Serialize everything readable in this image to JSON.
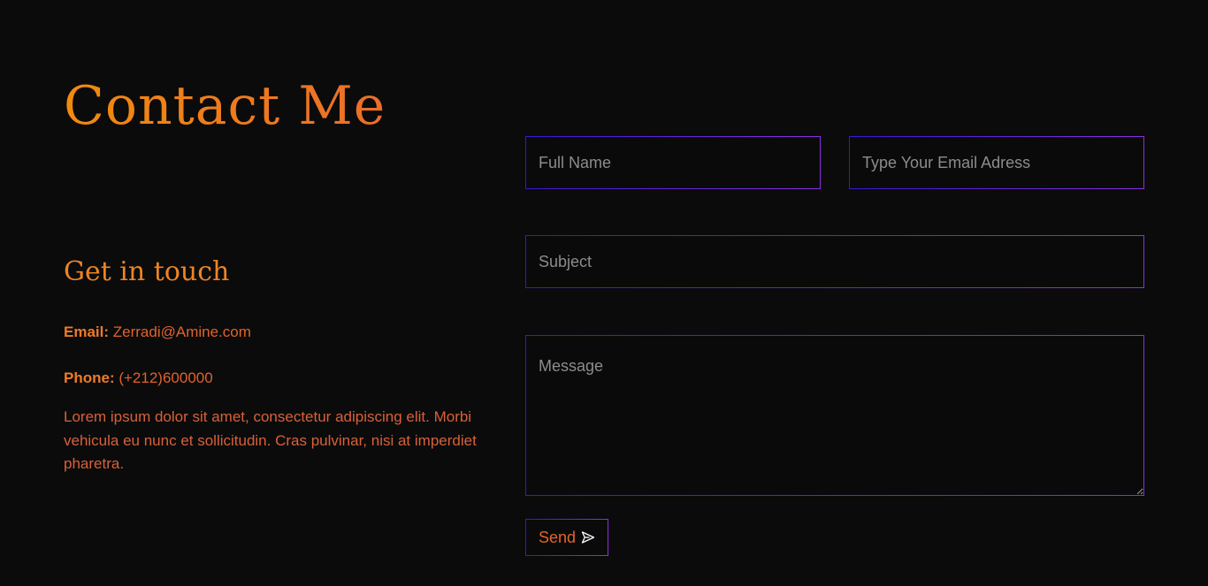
{
  "header": {
    "title": "Contact Me"
  },
  "info": {
    "heading": "Get in touch",
    "email_label": "Email:",
    "email_value": "Zerradi@Amine.com",
    "phone_label": "Phone:",
    "phone_value": "(+212)600000",
    "description": "Lorem ipsum dolor sit amet, consectetur adipiscing elit. Morbi vehicula eu nunc et sollicitudin. Cras pulvinar, nisi at imperdiet pharetra."
  },
  "form": {
    "fullname_placeholder": "Full Name",
    "fullname_value": "",
    "email_placeholder": "Type Your Email Adress",
    "email_value": "",
    "subject_placeholder": "Subject",
    "subject_value": "",
    "message_placeholder": "Message",
    "message_value": "",
    "send_label": "Send",
    "send_icon": "paper-plane-icon"
  },
  "colors": {
    "background": "#0b0b0b",
    "accent_orange": "#f28a0f",
    "accent_orange_red": "#e0622e",
    "border_gradient_start": "#3a17d8",
    "border_gradient_end": "#8a30e0",
    "placeholder": "#8c8c8c"
  }
}
